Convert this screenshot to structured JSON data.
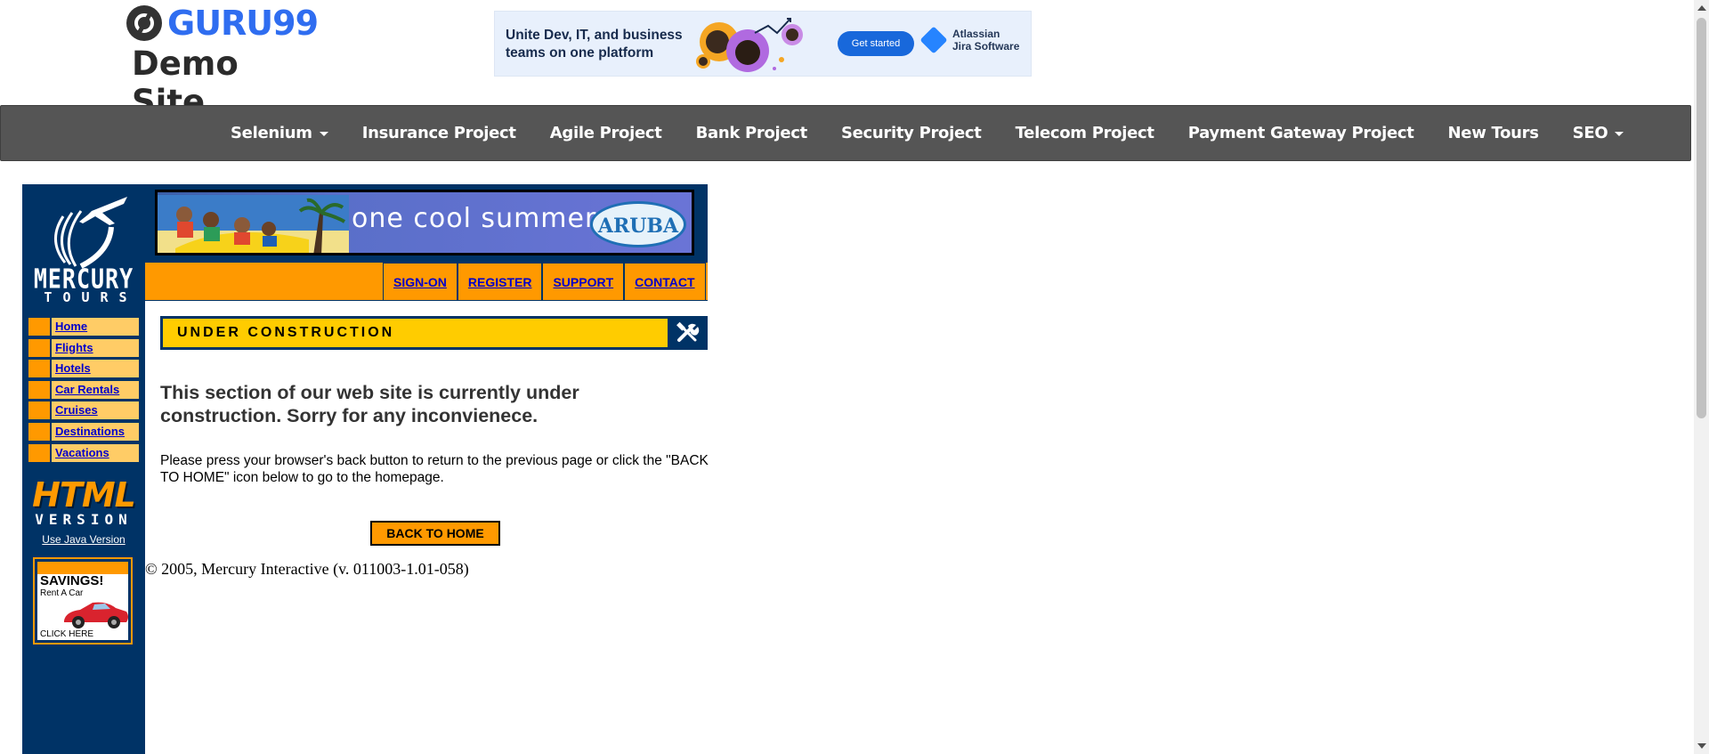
{
  "site": {
    "logo_name": "GURU99",
    "logo_sub": "Demo Site"
  },
  "ad": {
    "text": "Unite Dev, IT, and business teams on one platform",
    "button": "Get started",
    "brand_line1": "Atlassian",
    "brand_line2": "Jira Software"
  },
  "nav": {
    "items": [
      {
        "label": "Selenium",
        "dropdown": true
      },
      {
        "label": "Insurance Project"
      },
      {
        "label": "Agile Project"
      },
      {
        "label": "Bank Project"
      },
      {
        "label": "Security Project"
      },
      {
        "label": "Telecom Project"
      },
      {
        "label": "Payment Gateway Project"
      },
      {
        "label": "New Tours"
      },
      {
        "label": "SEO",
        "dropdown": true
      }
    ]
  },
  "mercury": {
    "brand_line1": "MERCURY",
    "brand_line2": "TOURS",
    "side_menu": [
      "Home",
      "Flights",
      "Hotels",
      "Car Rentals",
      "Cruises",
      "Destinations",
      "Vacations"
    ],
    "html_word": "HTML",
    "version_word": "VERSION",
    "java_link": "Use Java Version",
    "savings_title": "SAVINGS!",
    "savings_sub": "Rent A Car",
    "savings_click": "CLICK HERE"
  },
  "banner": {
    "text": "one cool summer",
    "brand": "ARUBA"
  },
  "top_menu": [
    "SIGN-ON",
    "REGISTER",
    "SUPPORT",
    "CONTACT"
  ],
  "content": {
    "section_title": "UNDER CONSTRUCTION",
    "heading": "This section of our web site is currently under construction.   Sorry for any inconvienece.",
    "body": "Please press your browser's back button to return to the previous page or click the \"BACK TO HOME\" icon below to go to the homepage.",
    "back_button": "BACK TO HOME",
    "copyright": "© 2005, Mercury Interactive (v. 011003-1.01-058)"
  },
  "colors": {
    "nav_bg": "#555555",
    "mercury_blue": "#003366",
    "orange": "#ff9900",
    "light_orange": "#ffcc66",
    "yellow": "#ffcc00",
    "link_blue": "#0000cc"
  }
}
